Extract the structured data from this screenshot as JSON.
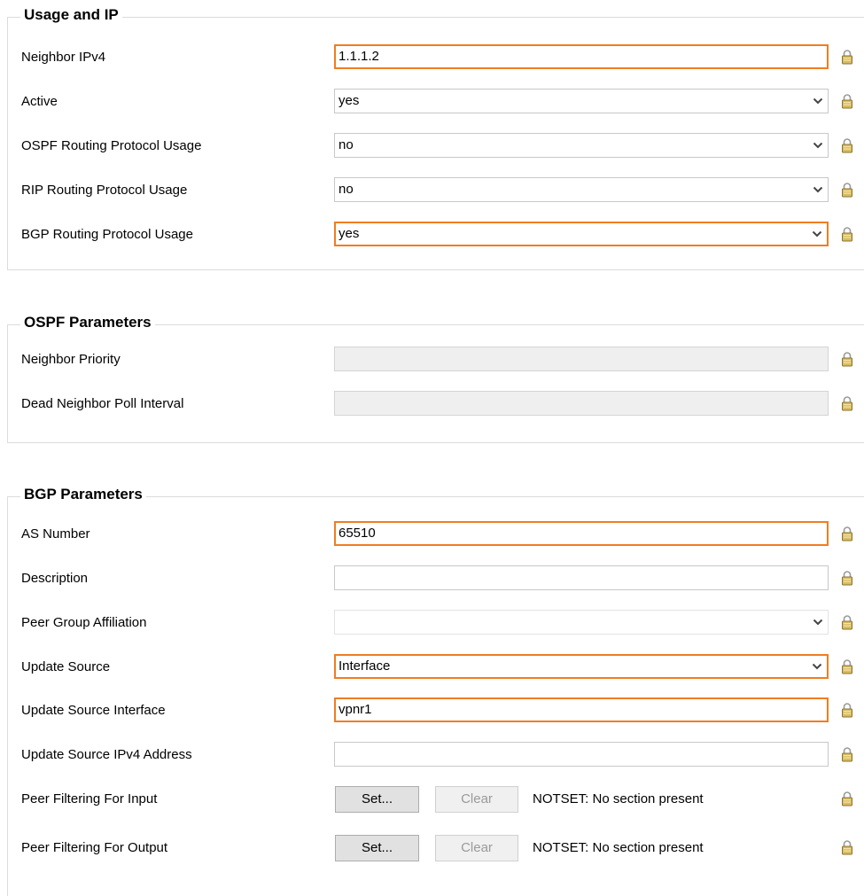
{
  "groups": {
    "usage": {
      "title": "Usage and IP",
      "neighbor_ipv4": {
        "label": "Neighbor IPv4",
        "value": "1.1.1.2"
      },
      "active": {
        "label": "Active",
        "value": "yes"
      },
      "ospf_usage": {
        "label": "OSPF Routing Protocol Usage",
        "value": "no"
      },
      "rip_usage": {
        "label": "RIP Routing Protocol Usage",
        "value": "no"
      },
      "bgp_usage": {
        "label": "BGP Routing Protocol Usage",
        "value": "yes"
      }
    },
    "ospf": {
      "title": "OSPF Parameters",
      "neighbor_priority": {
        "label": "Neighbor Priority",
        "value": ""
      },
      "dead_poll_interval": {
        "label": "Dead Neighbor Poll Interval",
        "value": ""
      }
    },
    "bgp": {
      "title": "BGP Parameters",
      "as_number": {
        "label": "AS Number",
        "value": "65510"
      },
      "description": {
        "label": "Description",
        "value": ""
      },
      "peer_group": {
        "label": "Peer Group Affiliation",
        "value": ""
      },
      "update_source": {
        "label": "Update Source",
        "value": "Interface"
      },
      "update_source_interface": {
        "label": "Update Source Interface",
        "value": "vpnr1"
      },
      "update_source_ipv4": {
        "label": "Update Source IPv4 Address",
        "value": ""
      },
      "filter_input": {
        "label": "Peer Filtering For Input",
        "set_label": "Set...",
        "clear_label": "Clear",
        "status": "NOTSET: No section present"
      },
      "filter_output": {
        "label": "Peer Filtering For Output",
        "set_label": "Set...",
        "clear_label": "Clear",
        "status": "NOTSET: No section present"
      }
    }
  },
  "icons": {
    "lock": "lock-icon",
    "dropdown": "chevron-down-icon"
  },
  "colors": {
    "highlight": "#f07d22",
    "lock": "#c9a84a"
  }
}
